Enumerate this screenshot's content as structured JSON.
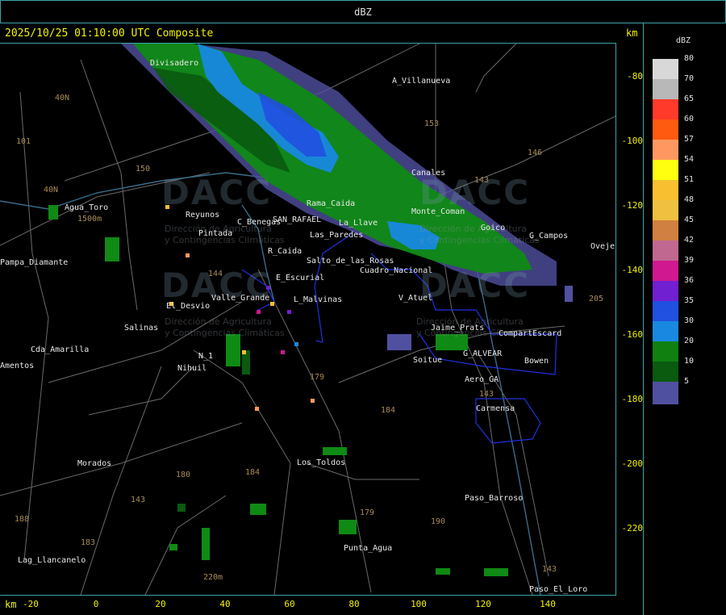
{
  "header": {
    "title": "dBZ"
  },
  "timestamp": "2025/10/25 01:10:00 UTC Composite",
  "units": {
    "top": "km",
    "bottom": "km"
  },
  "y_axis_ticks": [
    "-80",
    "-100",
    "-120",
    "-140",
    "-160",
    "-180",
    "-200",
    "-220"
  ],
  "x_axis_ticks": [
    "-20",
    "0",
    "20",
    "40",
    "60",
    "80",
    "100",
    "120",
    "140"
  ],
  "legend": {
    "title": "dBZ",
    "entries": [
      {
        "label": "80",
        "color": "#d8d8d8"
      },
      {
        "label": "70",
        "color": "#b8b8b8"
      },
      {
        "label": "65",
        "color": "#ff3a2a"
      },
      {
        "label": "60",
        "color": "#ff5a10"
      },
      {
        "label": "57",
        "color": "#ff9860"
      },
      {
        "label": "54",
        "color": "#ffff10"
      },
      {
        "label": "51",
        "color": "#f8c030"
      },
      {
        "label": "48",
        "color": "#f0c040"
      },
      {
        "label": "45",
        "color": "#d08040"
      },
      {
        "label": "42",
        "color": "#c06890"
      },
      {
        "label": "39",
        "color": "#d01890"
      },
      {
        "label": "36",
        "color": "#7020d0"
      },
      {
        "label": "35",
        "color": "#2050e0"
      },
      {
        "label": "30",
        "color": "#1888e0"
      },
      {
        "label": "20",
        "color": "#108010"
      },
      {
        "label": "10",
        "color": "#0a5a10"
      },
      {
        "label": "5",
        "color": "#5050a0"
      }
    ]
  },
  "places": [
    {
      "name": "Divisadero"
    },
    {
      "name": "A_Villanueva"
    },
    {
      "name": "Canales"
    },
    {
      "name": "Agua_Toro"
    },
    {
      "name": "Reyunos"
    },
    {
      "name": "C_Benegas"
    },
    {
      "name": "SAN_RAFAEL"
    },
    {
      "name": "La_Llave"
    },
    {
      "name": "Pintada"
    },
    {
      "name": "R_Caida"
    },
    {
      "name": "E_Escurial"
    },
    {
      "name": "L_Malvinas"
    },
    {
      "name": "V_Atuel"
    },
    {
      "name": "El_Desvio"
    },
    {
      "name": "Valle_Grande"
    },
    {
      "name": "Salinas"
    },
    {
      "name": "Cda_Amarilla"
    },
    {
      "name": "N_1"
    },
    {
      "name": "Nihuil"
    },
    {
      "name": "Morados"
    },
    {
      "name": "Los_Toldos"
    },
    {
      "name": "Soitue"
    },
    {
      "name": "G_ALVEAR"
    },
    {
      "name": "Bowen"
    },
    {
      "name": "CompartEscard"
    },
    {
      "name": "Carmensa"
    },
    {
      "name": "Paso_Barroso"
    },
    {
      "name": "Punta_Agua"
    },
    {
      "name": "Lag_Llancanelo"
    },
    {
      "name": "Paso_El_Loro"
    },
    {
      "name": "G_Campos"
    },
    {
      "name": "Goico"
    },
    {
      "name": "Pampa_Diamante"
    },
    {
      "name": "Ovejeria"
    },
    {
      "name": "Salto_de_las_Rosas"
    },
    {
      "name": "Monte_Coman"
    },
    {
      "name": "Jaime_Prats"
    },
    {
      "name": "Aero_GA"
    },
    {
      "name": "Cuadro_Nacional"
    },
    {
      "name": "Las_Paredes"
    },
    {
      "name": "Rama_Caida"
    },
    {
      "name": "Amentos"
    }
  ],
  "route_numbers": [
    "40N",
    "40N",
    "101",
    "150",
    "153",
    "146",
    "143",
    "144",
    "179",
    "184",
    "180",
    "184",
    "183",
    "179",
    "190",
    "143",
    "205",
    "143",
    "1500m",
    "220m",
    "188",
    "143"
  ],
  "watermark": {
    "logo_text": "DACC",
    "line1": "Dirección de Agricultura",
    "line2": "y Contingencias Climáticas"
  },
  "colors": {
    "frame": "#3aa3a8",
    "axis_text": "#f2f200",
    "province_border": "#2030e0",
    "roads": "#6a6a6a"
  }
}
